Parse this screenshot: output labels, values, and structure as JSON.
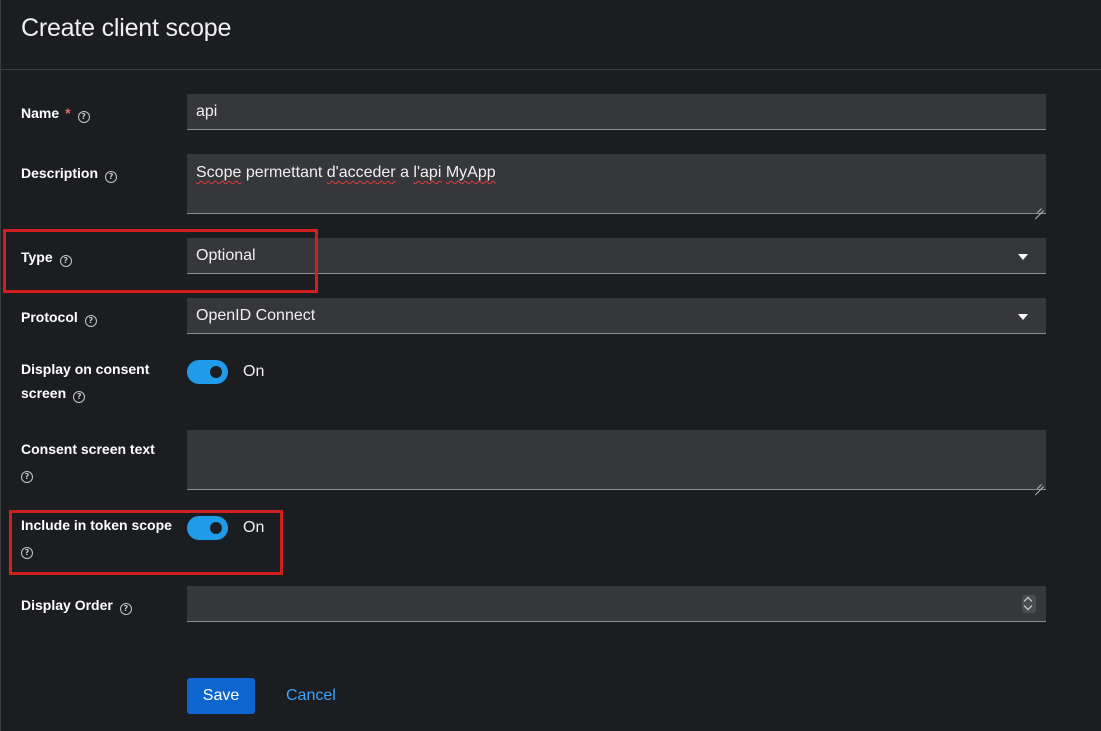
{
  "header": {
    "title": "Create client scope"
  },
  "form": {
    "name": {
      "label": "Name",
      "required_mark": "*",
      "value": "api"
    },
    "description": {
      "label": "Description",
      "value_parts": [
        "",
        "Scope",
        " permettant ",
        "d'acceder",
        " a ",
        "l'api",
        " ",
        "MyApp"
      ]
    },
    "type": {
      "label": "Type",
      "value": "Optional"
    },
    "protocol": {
      "label": "Protocol",
      "value": "OpenID Connect"
    },
    "display_consent": {
      "label_line1": "Display on consent",
      "label_line2": "screen",
      "toggle_text": "On",
      "on": true
    },
    "consent_text": {
      "label": "Consent screen text",
      "value": ""
    },
    "include_token_scope": {
      "label": "Include in token scope",
      "toggle_text": "On",
      "on": true
    },
    "display_order": {
      "label": "Display Order",
      "value": ""
    }
  },
  "actions": {
    "save_label": "Save",
    "cancel_label": "Cancel"
  },
  "icons": {
    "help": "help-circle-icon",
    "caret": "caret-down-icon"
  },
  "colors": {
    "accent": "#0d66d0",
    "toggle": "#1f9bea",
    "highlight": "#d01f1f",
    "link": "#3da5ff",
    "required": "#e56b6b"
  }
}
